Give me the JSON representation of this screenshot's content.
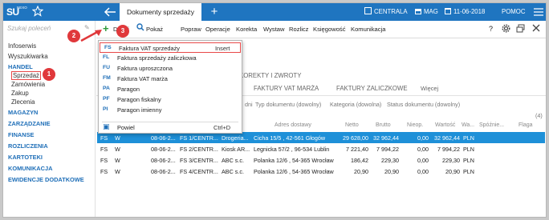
{
  "topbar": {
    "logo": "SU",
    "logo_sub": "NEXO",
    "tab_title": "Dokumenty sprzedaży",
    "company": "CENTRALA",
    "warehouse": "MAG",
    "date": "11-06-2018",
    "help": "POMOC"
  },
  "left": {
    "search_placeholder": "Szukaj poleceń",
    "items": {
      "infoserwis": "Infoserwis",
      "wyszukiwarka": "Wyszukiwarka",
      "handel": "HANDEL",
      "sprzedaz": "Sprzedaż",
      "zamowienia": "Zamówienia",
      "zakup": "Zakup",
      "zlecenia": "Zlecenia",
      "magazyn": "MAGAZYN",
      "zarzadzanie": "ZARZĄDZANIE",
      "finanse": "FINANSE",
      "rozliczenia": "ROZLICZENIA",
      "kartoteki": "KARTOTEKI",
      "komunikacja": "KOMUNIKACJA",
      "ewidencje": "EWIDENCJE DODATKOWE"
    }
  },
  "toolbar": {
    "dodaj": "Dodaj",
    "pokaz": "Pokaż",
    "popraw": "Popraw",
    "operacje": "Operacje",
    "korekta": "Korekta",
    "wystaw": "Wystaw",
    "rozlicz": "Rozlicz",
    "ksiegowosc": "Księgowość",
    "komunikacja": "Komunikacja",
    "help": "?"
  },
  "main": {
    "subtabs": {
      "korekty": "KOREKTY I ZWROTY",
      "vat_marza": "FAKTURY VAT MARŻA",
      "zaliczkowe": "FAKTURY ZALICZKOWE",
      "wiecej": "Więcej"
    },
    "filters": {
      "part": "dni",
      "typ": "Typ dokumentu (dowolny)",
      "kategoria": "Kategoria (dowolna)",
      "status": "Status dokumentu (dowolny)"
    },
    "count": "(4)",
    "columns": {
      "adres": "Adres dostawy",
      "netto": "Netto",
      "brutto": "Brutto",
      "nieop": "Nieop.",
      "wartosc": "Wartość",
      "wa": "Wa...",
      "spoznienie": "Spóźnie...",
      "flaga": "Flaga"
    },
    "rows": [
      {
        "typ": "FS",
        "st": "W",
        "data": "08-06-2...",
        "numer": "FS 1/CENTR...",
        "kontrahent": "Drogeria...",
        "adres": "Cicha 15/5 , 42-561 Głogów",
        "netto": "29 628,00",
        "brutto": "32 962,44",
        "nieop": "0,00",
        "wartosc": "32 962,44",
        "waluta": "PLN"
      },
      {
        "typ": "FS",
        "st": "W",
        "data": "08-06-2...",
        "numer": "FS 2/CENTR...",
        "kontrahent": "Kiosk AR...",
        "adres": "Legnicka 57/2 , 96-534 Lublin",
        "netto": "7 221,40",
        "brutto": "7 994,22",
        "nieop": "0,00",
        "wartosc": "7 994,22",
        "waluta": "PLN"
      },
      {
        "typ": "FS",
        "st": "W",
        "data": "08-06-2...",
        "numer": "FS 3/CENTR...",
        "kontrahent": "ABC s.c.",
        "adres": "Polanka 12/6 , 54-365 Wrocław",
        "netto": "186,42",
        "brutto": "229,30",
        "nieop": "0,00",
        "wartosc": "229,30",
        "waluta": "PLN"
      },
      {
        "typ": "FS",
        "st": "W",
        "data": "08-06-2...",
        "numer": "FS 4/CENTR...",
        "kontrahent": "ABC s.c.",
        "adres": "Polanka 12/6 , 54-365 Wrocław",
        "netto": "20,90",
        "brutto": "20,90",
        "nieop": "0,00",
        "wartosc": "20,90",
        "waluta": "PLN"
      }
    ]
  },
  "dropdown": {
    "items": [
      {
        "code": "FS",
        "label": "Faktura VAT sprzedaży",
        "shortcut": "Insert"
      },
      {
        "code": "FL",
        "label": "Faktura sprzedaży zaliczkowa",
        "shortcut": ""
      },
      {
        "code": "FU",
        "label": "Faktura uproszczona",
        "shortcut": ""
      },
      {
        "code": "FM",
        "label": "Faktura VAT marża",
        "shortcut": ""
      },
      {
        "code": "PA",
        "label": "Paragon",
        "shortcut": ""
      },
      {
        "code": "PF",
        "label": "Paragon fiskalny",
        "shortcut": ""
      },
      {
        "code": "PI",
        "label": "Paragon imienny",
        "shortcut": ""
      }
    ],
    "powiel": {
      "label": "Powiel",
      "shortcut": "Ctrl+D"
    }
  },
  "annotations": {
    "one": "1",
    "two": "2",
    "three": "3"
  },
  "colors": {
    "accent": "#1f75c0",
    "selected_row": "#1e90d8",
    "annotation": "#e0383b"
  }
}
